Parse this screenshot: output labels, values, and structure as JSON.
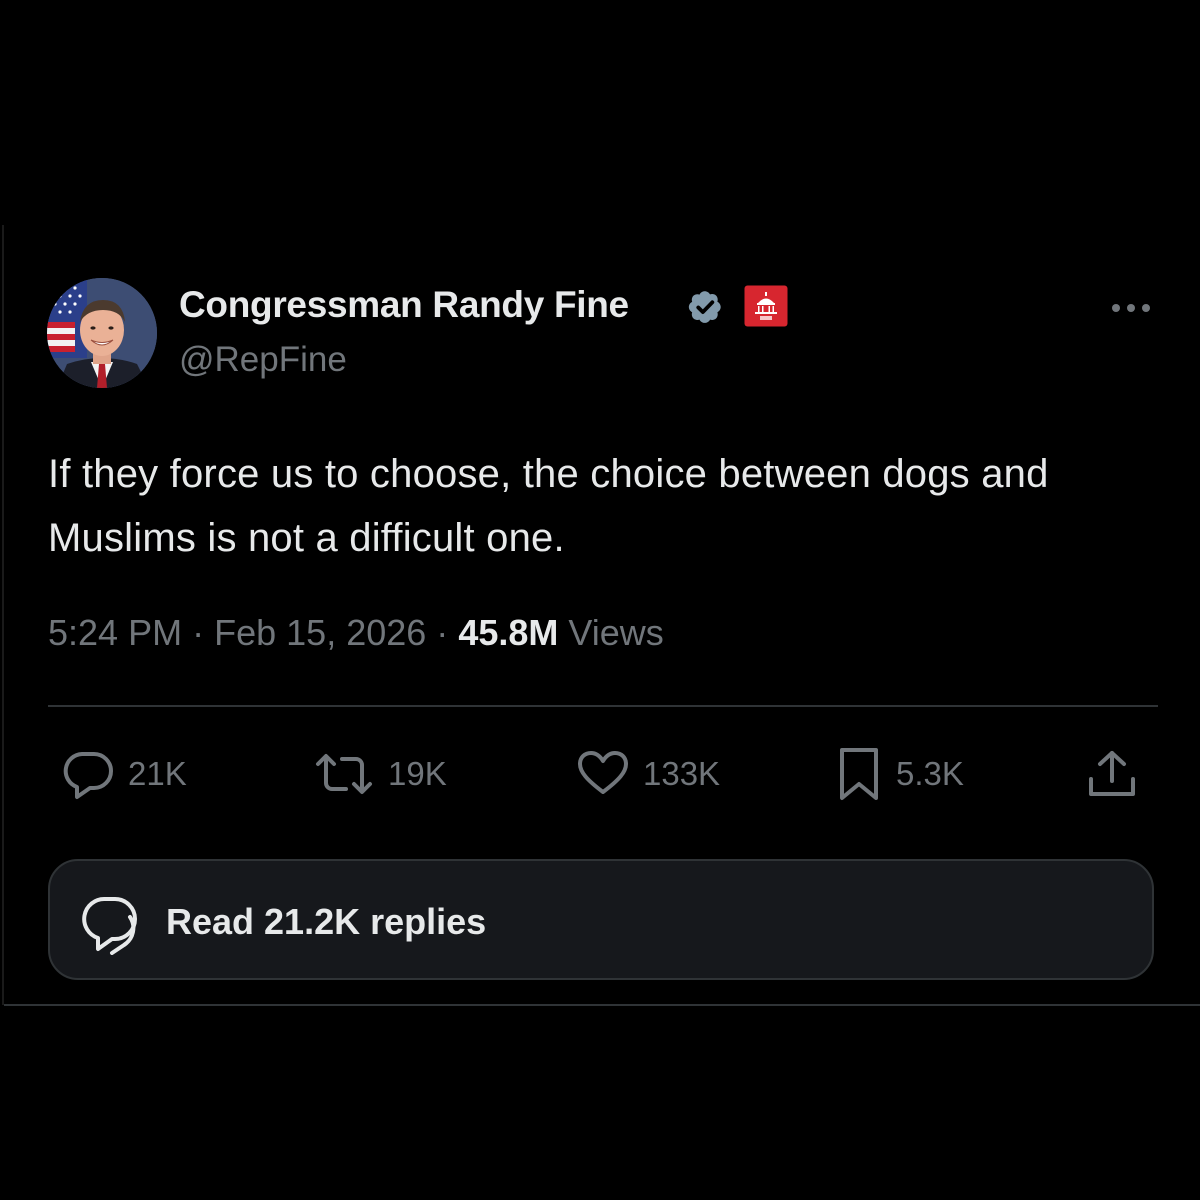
{
  "author": {
    "display_name": "Congressman Randy Fine",
    "handle": "@RepFine",
    "verified_badge_color": "#829aab",
    "affiliation_badge_color": "#d7262f"
  },
  "tweet": {
    "text": "If they force us to choose, the choice between dogs and Muslims is not a difficult one.",
    "time": "5:24 PM",
    "separator": "·",
    "date": "Feb 15, 2026",
    "views_count": "45.8M",
    "views_label": "Views"
  },
  "actions": {
    "replies": "21K",
    "reposts": "19K",
    "likes": "133K",
    "bookmarks": "5.3K"
  },
  "read_replies": {
    "label": "Read 21.2K replies"
  },
  "icons": {
    "more": "more-horizontal-icon",
    "reply": "reply-bubble-icon",
    "repost": "repost-icon",
    "like": "heart-icon",
    "bookmark": "bookmark-icon",
    "share": "share-upload-icon",
    "verified": "verified-badge-icon",
    "affiliation": "capitol-affiliation-icon",
    "read_replies": "conversation-bubbles-icon"
  },
  "colors": {
    "background": "#000000",
    "primary_text": "#e7e9ea",
    "secondary_text": "#71767b",
    "divider": "#2f3336"
  }
}
